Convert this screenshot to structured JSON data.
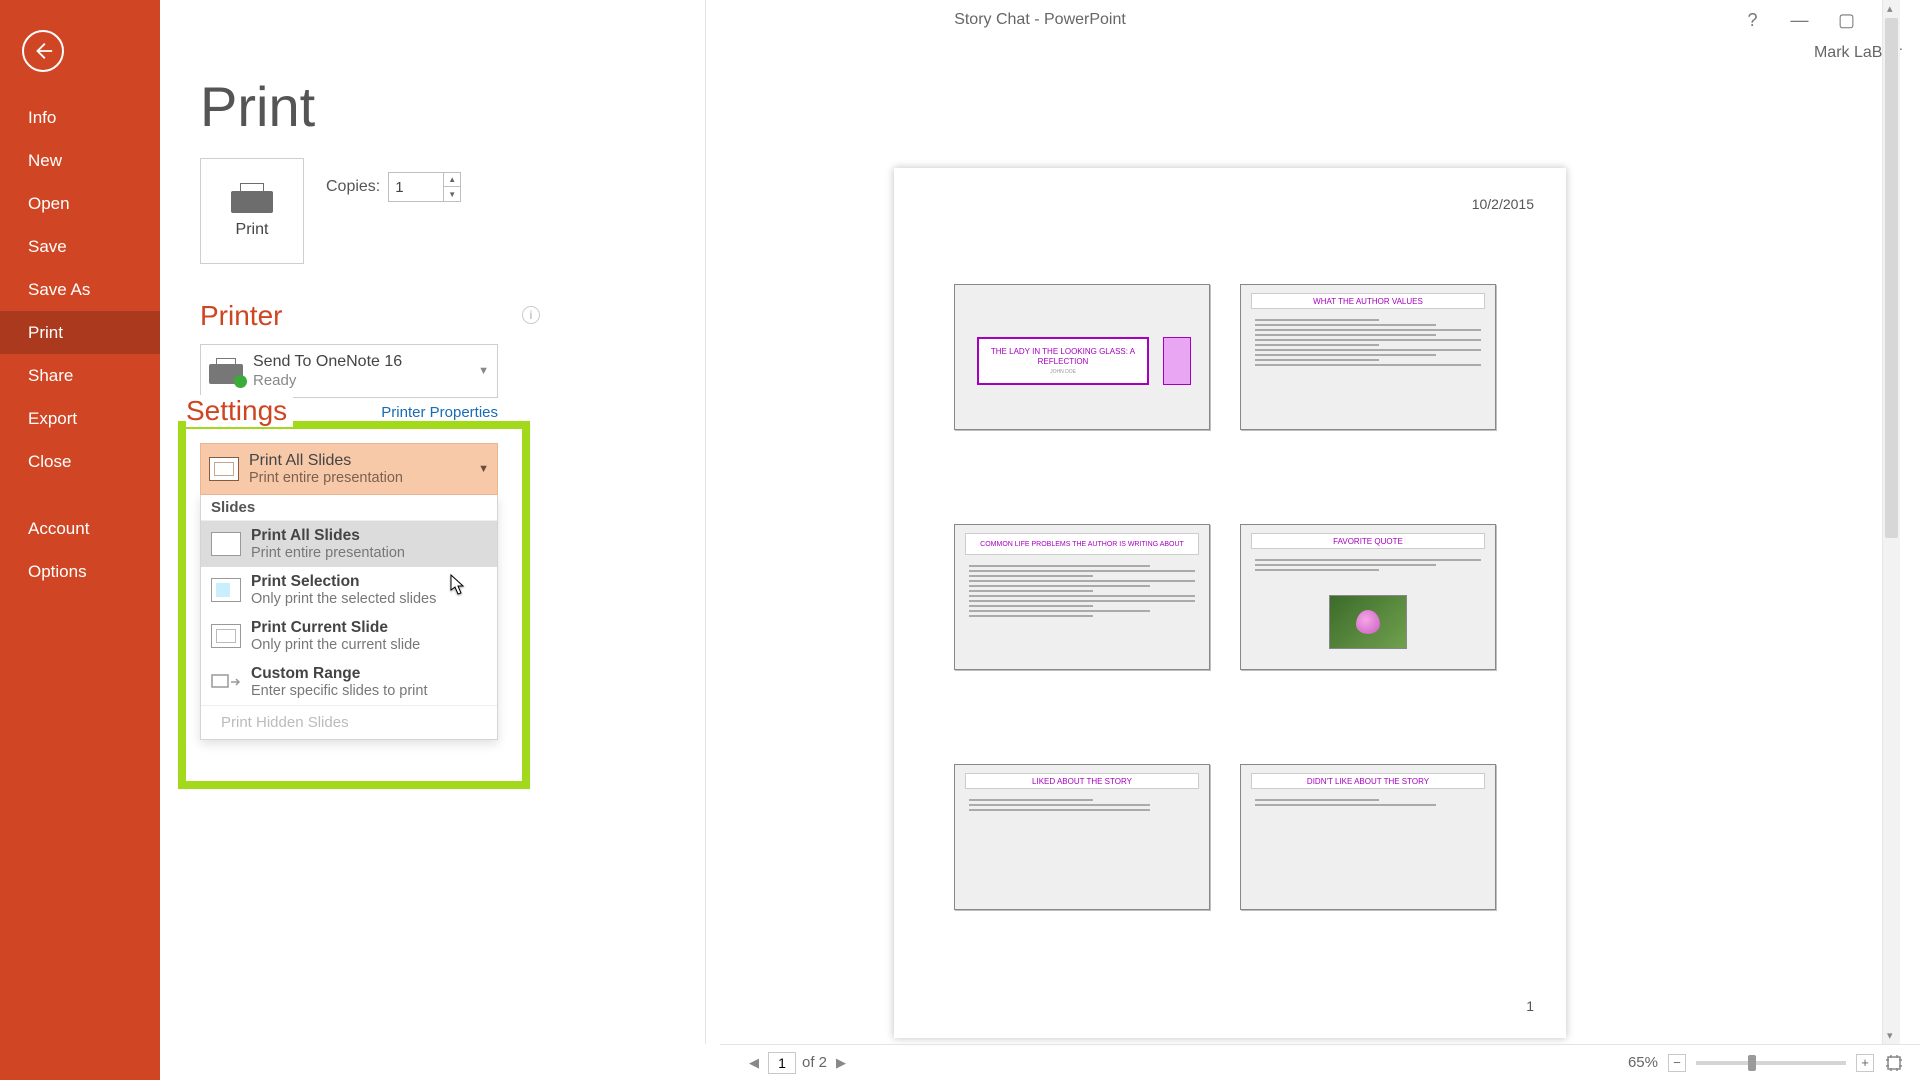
{
  "window": {
    "title": "Story Chat - PowerPoint",
    "account": "Mark LaBarr"
  },
  "nav": {
    "items": [
      "Info",
      "New",
      "Open",
      "Save",
      "Save As",
      "Print",
      "Share",
      "Export",
      "Close"
    ],
    "bottom_items": [
      "Account",
      "Options"
    ],
    "selected": "Print"
  },
  "page": {
    "title": "Print"
  },
  "print_button": {
    "label": "Print"
  },
  "copies": {
    "label": "Copies:",
    "value": "1"
  },
  "printer": {
    "section_title": "Printer",
    "name": "Send To OneNote 16",
    "status": "Ready",
    "properties_link": "Printer Properties"
  },
  "settings": {
    "section_title": "Settings",
    "selected": {
      "label": "Print All Slides",
      "desc": "Print entire presentation"
    },
    "dropdown": {
      "group_label": "Slides",
      "options": [
        {
          "label": "Print All Slides",
          "desc": "Print entire presentation"
        },
        {
          "label": "Print Selection",
          "desc": "Only print the selected slides"
        },
        {
          "label": "Print Current Slide",
          "desc": "Only print the current slide"
        },
        {
          "label": "Custom Range",
          "desc": "Enter specific slides to print"
        }
      ],
      "disabled_option": "Print Hidden Slides"
    }
  },
  "preview": {
    "date": "10/2/2015",
    "page_number": "1",
    "slides": [
      {
        "title": "THE LADY IN THE LOOKING GLASS: A REFLECTION",
        "author": "JOHN DOE"
      },
      {
        "title": "WHAT THE AUTHOR VALUES"
      },
      {
        "title": "COMMON LIFE PROBLEMS THE AUTHOR IS WRITING ABOUT"
      },
      {
        "title": "FAVORITE QUOTE"
      },
      {
        "title": "LIKED ABOUT THE STORY"
      },
      {
        "title": "DIDN'T LIKE ABOUT THE STORY"
      }
    ]
  },
  "footer": {
    "page_current": "1",
    "page_total": "of 2",
    "zoom_label": "65%"
  }
}
